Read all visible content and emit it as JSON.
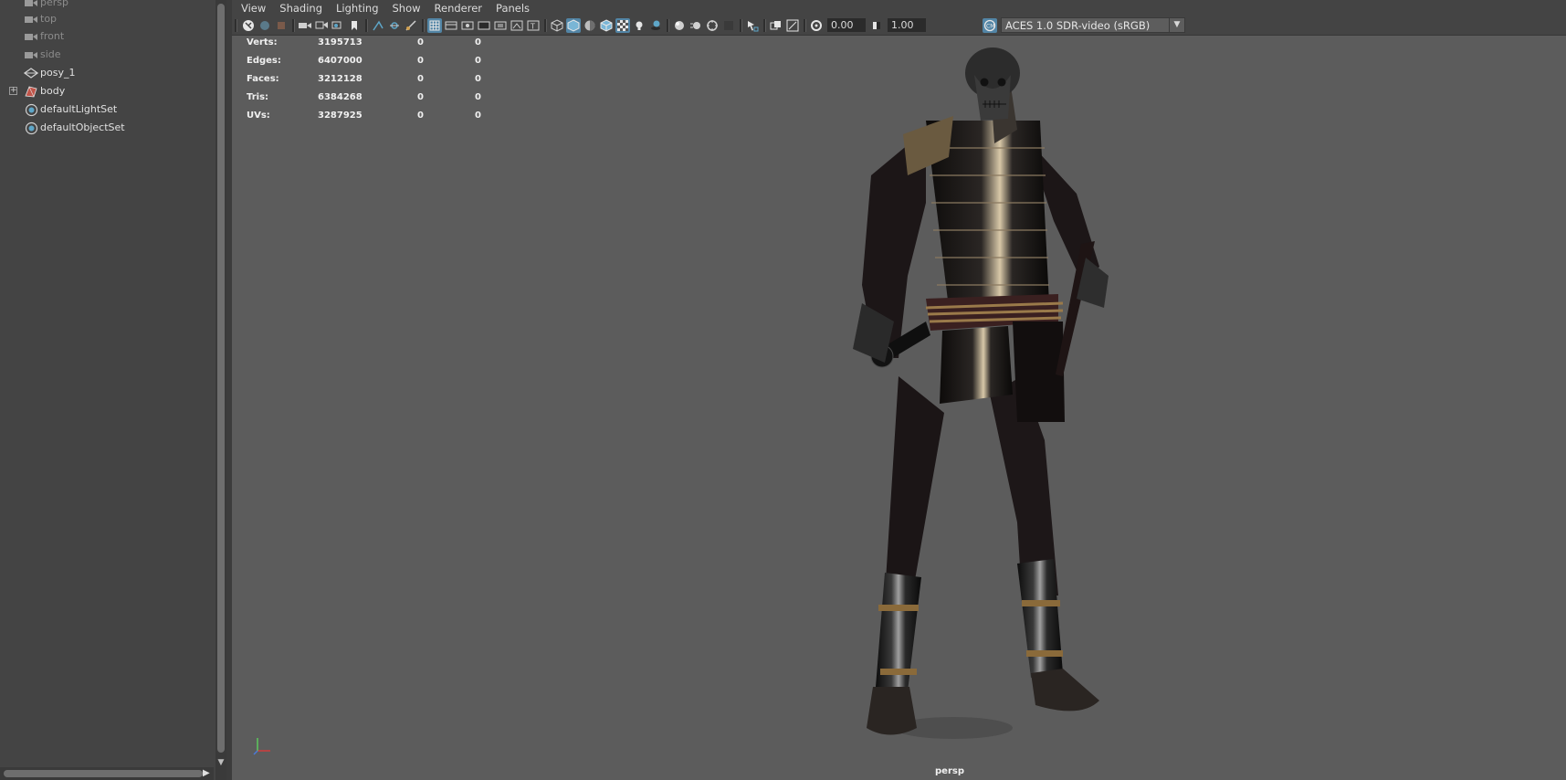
{
  "outliner": {
    "items": [
      {
        "label": "persp",
        "icon": "camera-icon",
        "dim": true
      },
      {
        "label": "top",
        "icon": "camera-icon",
        "dim": true
      },
      {
        "label": "front",
        "icon": "camera-icon",
        "dim": true
      },
      {
        "label": "side",
        "icon": "camera-icon",
        "dim": true
      },
      {
        "label": "posy_1",
        "icon": "transform-icon",
        "dim": false
      },
      {
        "label": "body",
        "icon": "mesh-icon",
        "dim": false,
        "expandable": true
      },
      {
        "label": "defaultLightSet",
        "icon": "set-icon",
        "dim": false
      },
      {
        "label": "defaultObjectSet",
        "icon": "set-icon",
        "dim": false
      }
    ]
  },
  "menubar": {
    "items": [
      "View",
      "Shading",
      "Lighting",
      "Show",
      "Renderer",
      "Panels"
    ]
  },
  "toolbar": {
    "exposure_value": "0.00",
    "gamma_value": "1.00",
    "color_space": "ACES 1.0 SDR-video (sRGB)"
  },
  "hud": {
    "rows": [
      {
        "label": "Verts:",
        "total": "3195713",
        "sel": "0",
        "comp": "0"
      },
      {
        "label": "Edges:",
        "total": "6407000",
        "sel": "0",
        "comp": "0"
      },
      {
        "label": "Faces:",
        "total": "3212128",
        "sel": "0",
        "comp": "0"
      },
      {
        "label": "Tris:",
        "total": "6384268",
        "sel": "0",
        "comp": "0"
      },
      {
        "label": "UVs:",
        "total": "3287925",
        "sel": "0",
        "comp": "0"
      }
    ]
  },
  "viewport": {
    "camera_name": "persp",
    "scene_object": "samurai-armor-model"
  },
  "colors": {
    "panel_bg": "#444444",
    "viewport_bg": "#5c5c5c",
    "accent": "#5285a6"
  }
}
